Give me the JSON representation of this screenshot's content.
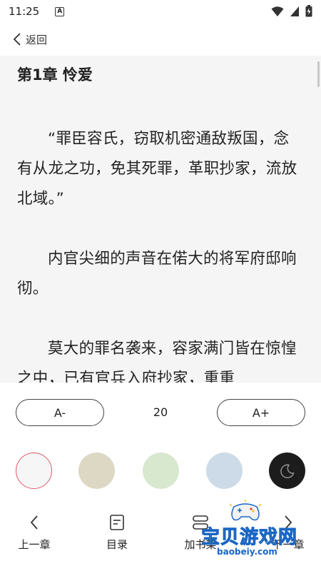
{
  "status_bar": {
    "time": "11:25",
    "notification_glyph": "A"
  },
  "nav": {
    "back_label": "返回"
  },
  "reader": {
    "chapter_title": "第1章 怜爱",
    "paragraphs": [
      "“罪臣容氏，窃取机密通敌叛国，念有从龙之功，免其死罪，革职抄家，流放北域。”",
      "内官尖细的声音在偌大的将军府邸响彻。",
      "莫大的罪名袭来，容家满门皆在惊惶之中，已有官兵入府抄家，重重"
    ]
  },
  "settings": {
    "font_decrease_label": "A-",
    "font_size": "20",
    "font_increase_label": "A+",
    "themes": [
      {
        "name": "white",
        "color": "#f6f6f6",
        "selected": true
      },
      {
        "name": "parchment",
        "color": "#ddd8c4",
        "selected": false
      },
      {
        "name": "green",
        "color": "#d7e8cf",
        "selected": false
      },
      {
        "name": "blue",
        "color": "#cddbe8",
        "selected": false
      },
      {
        "name": "night",
        "color": "#1c1c1c",
        "selected": false
      }
    ],
    "selected_ring_color": "#e05a6c"
  },
  "bottom_nav": {
    "prev_label": "上一章",
    "catalog_label": "目录",
    "bookshelf_label": "加书架",
    "next_label": "下一章"
  },
  "watermark": {
    "text": "宝贝游戏网",
    "url": "baobeiy.com"
  }
}
